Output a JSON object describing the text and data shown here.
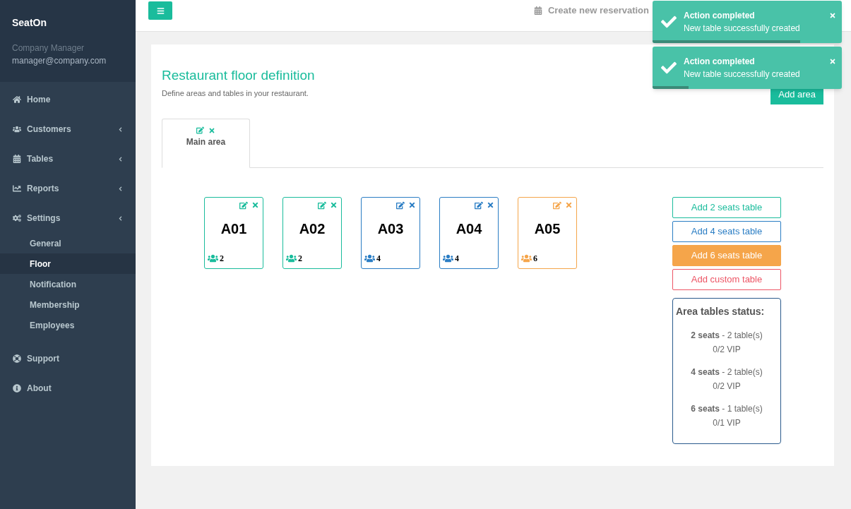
{
  "sidebar": {
    "brand": "SeatOn",
    "role": "Company Manager",
    "email": "manager@company.com",
    "items": [
      {
        "label": "Home",
        "expandable": false,
        "selected": false
      },
      {
        "label": "Customers",
        "expandable": true,
        "selected": false
      },
      {
        "label": "Tables",
        "expandable": true,
        "selected": false
      },
      {
        "label": "Reports",
        "expandable": true,
        "selected": false
      },
      {
        "label": "Settings",
        "expandable": true,
        "selected": false,
        "children": [
          {
            "label": "General",
            "selected": false
          },
          {
            "label": "Floor",
            "selected": true
          },
          {
            "label": "Notification",
            "selected": false
          },
          {
            "label": "Membership",
            "selected": false
          },
          {
            "label": "Employees",
            "selected": false
          }
        ]
      },
      {
        "label": "Support",
        "expandable": false,
        "selected": false
      },
      {
        "label": "About",
        "expandable": false,
        "selected": false
      }
    ]
  },
  "header": {
    "nav": [
      {
        "label": "Create new reservation"
      }
    ]
  },
  "toasts": [
    {
      "title": "Action completed",
      "message": "New table successfully created",
      "level": 0.78
    },
    {
      "title": "Action completed",
      "message": "New table successfully created",
      "level": 0.19
    }
  ],
  "page": {
    "title": "Restaurant floor definition",
    "subtitle": "Define areas and tables in your restaurant.",
    "add_area": "Add area",
    "areas": [
      {
        "label": "Main area",
        "selected": true
      }
    ],
    "tables": [
      {
        "name": "A01",
        "seats": "2",
        "color": "#1abc9c"
      },
      {
        "name": "A02",
        "seats": "2",
        "color": "#1abc9c"
      },
      {
        "name": "A03",
        "seats": "4",
        "color": "#2a7dc4"
      },
      {
        "name": "A04",
        "seats": "4",
        "color": "#2a7dc4"
      },
      {
        "name": "A05",
        "seats": "6",
        "color": "#f5a54a"
      }
    ],
    "add_buttons": [
      {
        "label": "Add 2 seats table",
        "color": "#1abc9c",
        "hover": false
      },
      {
        "label": "Add 4 seats table",
        "color": "#2a7dc4",
        "hover": false
      },
      {
        "label": "Add 6 seats table",
        "color": "#f5a54a",
        "hover": true
      },
      {
        "label": "Add custom table",
        "color": "#ed5565",
        "hover": false
      }
    ],
    "status": {
      "title": "Area tables status:",
      "groups": [
        {
          "line": "**2 seats** - 2 table(s)",
          "vip": "0/2 VIP"
        },
        {
          "line": "**4 seats** - 2 table(s)",
          "vip": "0/2 VIP"
        },
        {
          "line": "**6 seats** - 1 table(s)",
          "vip": "0/1 VIP"
        }
      ]
    }
  }
}
